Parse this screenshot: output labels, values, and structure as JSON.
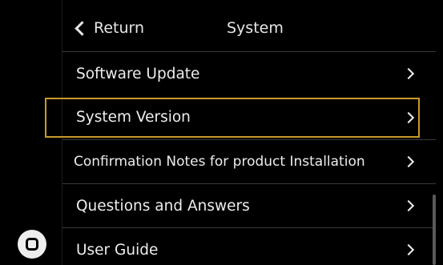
{
  "header": {
    "return_label": "Return",
    "title": "System"
  },
  "menu": {
    "items": [
      {
        "label": "Software Update"
      },
      {
        "label": "System Version"
      },
      {
        "label": "Confirmation Notes for product Installation"
      },
      {
        "label": "Questions and Answers"
      },
      {
        "label": "User Guide"
      }
    ],
    "selected_index": 1
  },
  "colors": {
    "background": "#000000",
    "text": "#ededed",
    "divider": "#3a3a3a",
    "focus_border": "#c79a2a"
  },
  "icons": {
    "home": "home-button-icon",
    "back": "chevron-left-icon",
    "row_arrow": "chevron-right-icon"
  }
}
